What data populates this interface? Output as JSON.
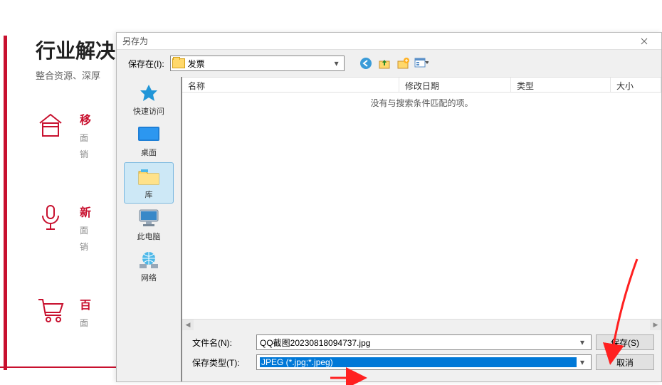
{
  "bg": {
    "title": "行业解决",
    "subtitle": "整合资源、深厚",
    "items": [
      {
        "title": "移",
        "line1": "面",
        "line2": "销"
      },
      {
        "title": "新",
        "line1": "面",
        "line2": "销"
      },
      {
        "title": "百",
        "line1": "面"
      }
    ]
  },
  "dialog": {
    "title": "另存为",
    "save_in_label": "保存在(I):",
    "save_in_value": "发票",
    "columns": {
      "name": "名称",
      "date": "修改日期",
      "type": "类型",
      "size": "大小"
    },
    "empty_message": "没有与搜索条件匹配的项。",
    "sidebar": [
      {
        "label": "快速访问"
      },
      {
        "label": "桌面"
      },
      {
        "label": "库"
      },
      {
        "label": "此电脑"
      },
      {
        "label": "网络"
      }
    ],
    "filename_label": "文件名(N):",
    "filename_value": "QQ截图20230818094737.jpg",
    "filetype_label": "保存类型(T):",
    "filetype_value": "JPEG (*.jpg;*.jpeg)",
    "save_btn": "保存(S)",
    "cancel_btn": "取消"
  }
}
